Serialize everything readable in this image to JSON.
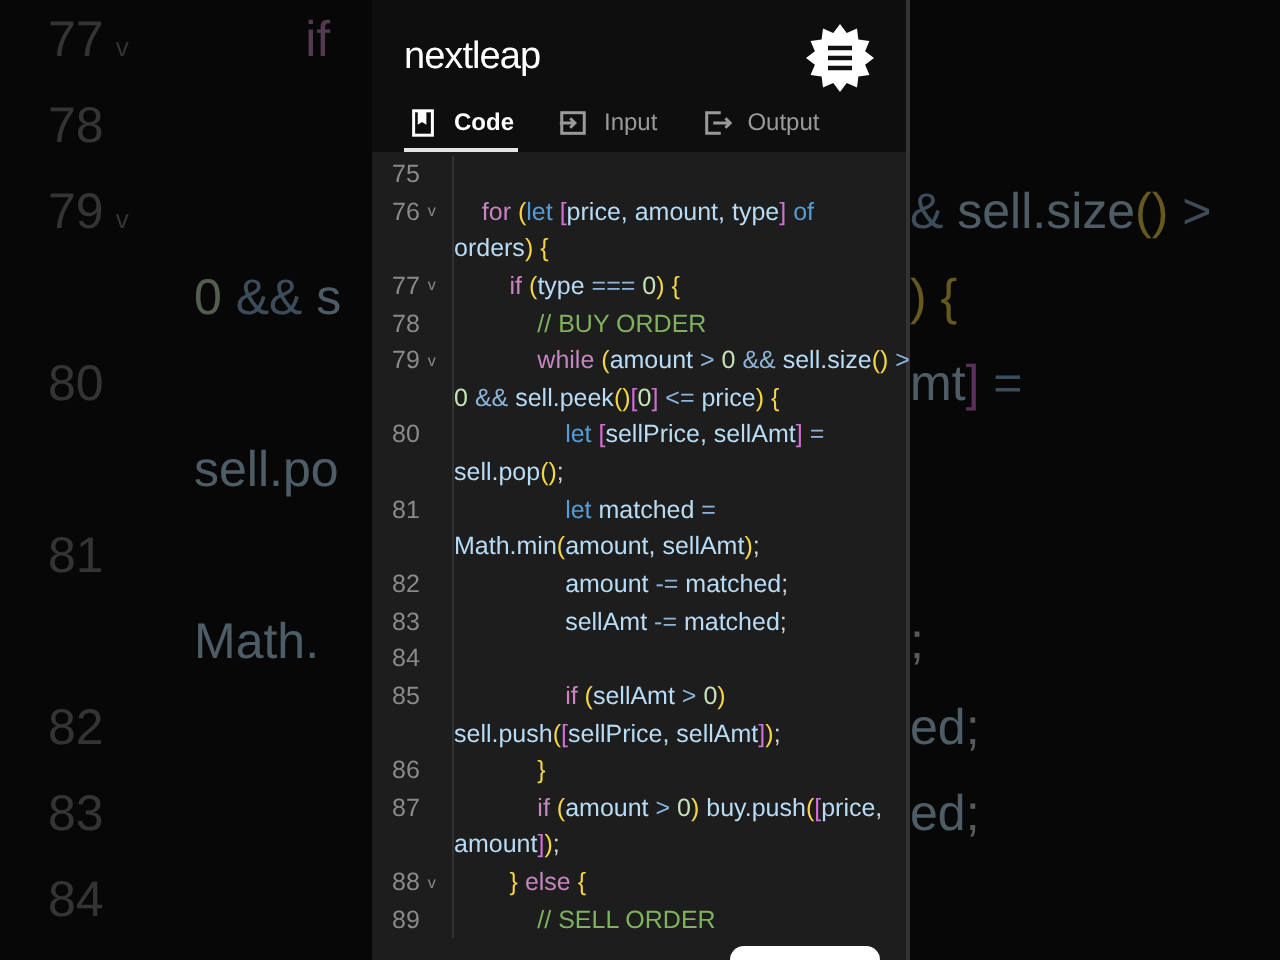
{
  "background": {
    "rows": [
      {
        "number": "77",
        "fold_mark": "v",
        "left": [
          {
            "kind": "kw",
            "text": "        if"
          }
        ]
      },
      {
        "number": "78"
      },
      {
        "number": "79",
        "fold_mark": "v",
        "right": [
          {
            "kind": "op",
            "text": "& "
          },
          {
            "kind": "var",
            "text": "sell.size"
          },
          {
            "kind": "paren",
            "text": "()"
          },
          {
            "kind": "op",
            "text": " >"
          }
        ]
      },
      {
        "left": [
          {
            "kind": "num",
            "text": "0 "
          },
          {
            "kind": "op",
            "text": "&& "
          },
          {
            "kind": "var",
            "text": "s"
          }
        ],
        "right": [
          {
            "kind": "paren",
            "text": ") {"
          }
        ]
      },
      {
        "number": "80",
        "right": [
          {
            "kind": "var",
            "text": "mt"
          },
          {
            "kind": "brk",
            "text": "]"
          },
          {
            "kind": "op",
            "text": " ="
          }
        ]
      },
      {
        "left": [
          {
            "kind": "var",
            "text": "sell.po"
          }
        ]
      },
      {
        "number": "81"
      },
      {
        "left": [
          {
            "kind": "var",
            "text": "Math."
          }
        ],
        "right": [
          {
            "kind": "punc",
            "text": ";"
          }
        ]
      },
      {
        "number": "82",
        "right": [
          {
            "kind": "var",
            "text": "ed"
          },
          {
            "kind": "punc",
            "text": ";"
          }
        ]
      },
      {
        "number": "83",
        "right": [
          {
            "kind": "var",
            "text": "ed"
          },
          {
            "kind": "punc",
            "text": ";"
          }
        ]
      },
      {
        "number": "84"
      }
    ]
  },
  "app": {
    "brand": "nextleap",
    "tabs": [
      {
        "label": "Code",
        "selected": true
      },
      {
        "label": "Input",
        "selected": false
      },
      {
        "label": "Output",
        "selected": false
      }
    ],
    "code": [
      {
        "number": "75"
      },
      {
        "number": "76",
        "fold_mark": "v",
        "tokens": [
          {
            "kind": "kw",
            "text": "    for "
          },
          {
            "kind": "paren",
            "text": "("
          },
          {
            "kind": "decl",
            "text": "let "
          },
          {
            "kind": "brk",
            "text": "["
          },
          {
            "kind": "var",
            "text": "price, amount, type"
          },
          {
            "kind": "brk",
            "text": "]"
          },
          {
            "kind": "decl",
            "text": " of"
          }
        ]
      },
      {
        "tokens": [
          {
            "kind": "var",
            "text": "orders"
          },
          {
            "kind": "paren",
            "text": ") {"
          }
        ]
      },
      {
        "number": "77",
        "fold_mark": "v",
        "tokens": [
          {
            "kind": "kw",
            "text": "        if "
          },
          {
            "kind": "paren",
            "text": "("
          },
          {
            "kind": "var",
            "text": "type "
          },
          {
            "kind": "op",
            "text": "=== "
          },
          {
            "kind": "num",
            "text": "0"
          },
          {
            "kind": "paren",
            "text": ") {"
          }
        ]
      },
      {
        "number": "78",
        "tokens": [
          {
            "kind": "cmt",
            "text": "            // BUY ORDER"
          }
        ]
      },
      {
        "number": "79",
        "fold_mark": "v",
        "tokens": [
          {
            "kind": "kw",
            "text": "            while "
          },
          {
            "kind": "paren",
            "text": "("
          },
          {
            "kind": "var",
            "text": "amount "
          },
          {
            "kind": "op",
            "text": "> "
          },
          {
            "kind": "num",
            "text": "0 "
          },
          {
            "kind": "op",
            "text": "&& "
          },
          {
            "kind": "var",
            "text": "sell.size"
          },
          {
            "kind": "paren",
            "text": "()"
          },
          {
            "kind": "op",
            "text": " >"
          }
        ]
      },
      {
        "tokens": [
          {
            "kind": "num",
            "text": "0 "
          },
          {
            "kind": "op",
            "text": "&& "
          },
          {
            "kind": "var",
            "text": "sell.peek"
          },
          {
            "kind": "paren",
            "text": "()"
          },
          {
            "kind": "brk",
            "text": "["
          },
          {
            "kind": "num",
            "text": "0"
          },
          {
            "kind": "brk",
            "text": "]"
          },
          {
            "kind": "op",
            "text": " <= "
          },
          {
            "kind": "var",
            "text": "price"
          },
          {
            "kind": "paren",
            "text": ") {"
          }
        ]
      },
      {
        "number": "80",
        "tokens": [
          {
            "kind": "decl",
            "text": "                let "
          },
          {
            "kind": "brk",
            "text": "["
          },
          {
            "kind": "var",
            "text": "sellPrice, sellAmt"
          },
          {
            "kind": "brk",
            "text": "]"
          },
          {
            "kind": "op",
            "text": " ="
          }
        ]
      },
      {
        "tokens": [
          {
            "kind": "var",
            "text": "sell.pop"
          },
          {
            "kind": "paren",
            "text": "()"
          },
          {
            "kind": "punc",
            "text": ";"
          }
        ]
      },
      {
        "number": "81",
        "tokens": [
          {
            "kind": "decl",
            "text": "                let "
          },
          {
            "kind": "var",
            "text": "matched "
          },
          {
            "kind": "op",
            "text": "="
          }
        ]
      },
      {
        "tokens": [
          {
            "kind": "var",
            "text": "Math.min"
          },
          {
            "kind": "paren",
            "text": "("
          },
          {
            "kind": "var",
            "text": "amount, sellAmt"
          },
          {
            "kind": "paren",
            "text": ")"
          },
          {
            "kind": "punc",
            "text": ";"
          }
        ]
      },
      {
        "number": "82",
        "tokens": [
          {
            "kind": "var",
            "text": "                amount "
          },
          {
            "kind": "op",
            "text": "-= "
          },
          {
            "kind": "var",
            "text": "matched"
          },
          {
            "kind": "punc",
            "text": ";"
          }
        ]
      },
      {
        "number": "83",
        "tokens": [
          {
            "kind": "var",
            "text": "                sellAmt "
          },
          {
            "kind": "op",
            "text": "-= "
          },
          {
            "kind": "var",
            "text": "matched"
          },
          {
            "kind": "punc",
            "text": ";"
          }
        ]
      },
      {
        "number": "84"
      },
      {
        "number": "85",
        "tokens": [
          {
            "kind": "kw",
            "text": "                if "
          },
          {
            "kind": "paren",
            "text": "("
          },
          {
            "kind": "var",
            "text": "sellAmt "
          },
          {
            "kind": "op",
            "text": "> "
          },
          {
            "kind": "num",
            "text": "0"
          },
          {
            "kind": "paren",
            "text": ")"
          }
        ]
      },
      {
        "tokens": [
          {
            "kind": "var",
            "text": "sell.push"
          },
          {
            "kind": "paren",
            "text": "("
          },
          {
            "kind": "brk",
            "text": "["
          },
          {
            "kind": "var",
            "text": "sellPrice, sellAmt"
          },
          {
            "kind": "brk",
            "text": "]"
          },
          {
            "kind": "paren",
            "text": ")"
          },
          {
            "kind": "punc",
            "text": ";"
          }
        ]
      },
      {
        "number": "86",
        "tokens": [
          {
            "kind": "paren",
            "text": "            }"
          }
        ]
      },
      {
        "number": "87",
        "tokens": [
          {
            "kind": "kw",
            "text": "            if "
          },
          {
            "kind": "paren",
            "text": "("
          },
          {
            "kind": "var",
            "text": "amount "
          },
          {
            "kind": "op",
            "text": "> "
          },
          {
            "kind": "num",
            "text": "0"
          },
          {
            "kind": "paren",
            "text": ")"
          },
          {
            "kind": "var",
            "text": " buy.push"
          },
          {
            "kind": "paren",
            "text": "("
          },
          {
            "kind": "brk",
            "text": "["
          },
          {
            "kind": "var",
            "text": "price,"
          }
        ]
      },
      {
        "tokens": [
          {
            "kind": "var",
            "text": "amount"
          },
          {
            "kind": "brk",
            "text": "]"
          },
          {
            "kind": "paren",
            "text": ")"
          },
          {
            "kind": "punc",
            "text": ";"
          }
        ]
      },
      {
        "number": "88",
        "fold_mark": "v",
        "tokens": [
          {
            "kind": "paren",
            "text": "        }"
          },
          {
            "kind": "kw",
            "text": " else "
          },
          {
            "kind": "paren",
            "text": "{"
          }
        ]
      },
      {
        "number": "89",
        "tokens": [
          {
            "kind": "cmt",
            "text": "            // SELL ORDER"
          }
        ]
      }
    ]
  }
}
